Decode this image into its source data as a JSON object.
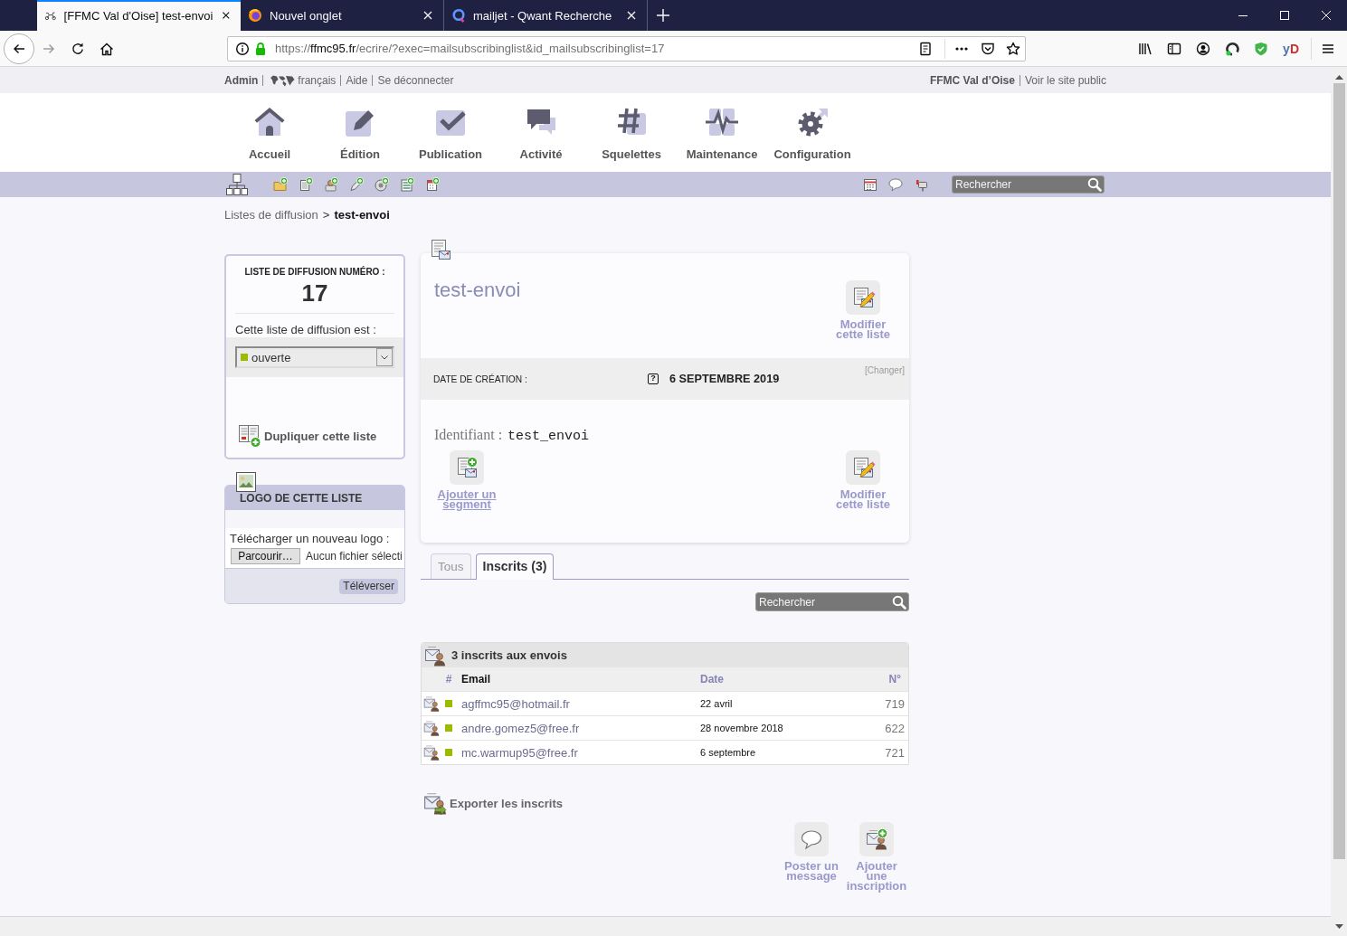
{
  "browser": {
    "tabs": [
      {
        "title": "[FFMC Val d'Oise] test-envoi",
        "kind": "site",
        "selected": true
      },
      {
        "title": "Nouvel onglet",
        "kind": "browser",
        "selected": false
      },
      {
        "title": "mailjet - Qwant Recherche",
        "kind": "search",
        "selected": false
      }
    ],
    "address": {
      "scheme": "https://",
      "host": "ffmc95.fr",
      "path": "/ecrire/?exec=mailsubscribinglist&id_mailsubscribinglist=17"
    },
    "extension_label": "yD"
  },
  "admin_bar": {
    "user": "Admin",
    "language": "français",
    "links": [
      "Aide",
      "Se déconnecter"
    ],
    "site_name": "FFMC Val d’Oise",
    "site_link": "Voir le site public"
  },
  "main_nav": [
    {
      "label": "Accueil",
      "kind": "home"
    },
    {
      "label": "Édition",
      "kind": "edit"
    },
    {
      "label": "Publication",
      "kind": "publish"
    },
    {
      "label": "Activité",
      "kind": "activity"
    },
    {
      "label": "Squelettes",
      "kind": "templates"
    },
    {
      "label": "Maintenance",
      "kind": "maintenance"
    },
    {
      "label": "Configuration",
      "kind": "config"
    }
  ],
  "toolbar": {
    "search": {
      "placeholder": "Rechercher"
    }
  },
  "breadcrumb": {
    "items": [
      {
        "label": "Listes de diffusion",
        "kind": "link"
      },
      {
        "label": "test-envoi",
        "kind": "current"
      }
    ],
    "separator": ">"
  },
  "sidebar": {
    "list_number": {
      "label": "LISTE DE DIFFUSION NUMÉRO :",
      "value": "17"
    },
    "status": {
      "label": "Cette liste de diffusion est :",
      "value": "ouverte"
    },
    "duplicate": "Dupliquer cette liste",
    "logo": {
      "title": "LOGO DE CETTE LISTE",
      "upload_label": "Télécharger un nouveau logo :",
      "browse": "Parcourir…",
      "file": "Aucun fichier sélecti",
      "submit": "Téléverser"
    }
  },
  "list_card": {
    "title": "test-envoi",
    "header_action": {
      "label": "Modifier cette liste",
      "kind": "edit"
    },
    "creation_date": {
      "label": "DATE DE CRÉATION :",
      "help": "?",
      "value": "6 SEPTEMBRE 2019",
      "change": "[Changer]"
    },
    "identifier": {
      "label": "Identifiant :",
      "value": "test_envoi"
    },
    "actions": [
      {
        "label": "Ajouter un segment",
        "kind": "segment"
      },
      {
        "label": "Modifier cette liste",
        "kind": "edit"
      }
    ]
  },
  "subscriber_tabs": [
    {
      "label": "Tous",
      "selected": false
    },
    {
      "label": "Inscrits (3)",
      "selected": true
    }
  ],
  "search": {
    "placeholder": "Rechercher"
  },
  "subscribers": {
    "title": "3 inscrits aux envois",
    "columns": [
      {
        "label": "#",
        "sorted": false
      },
      {
        "label": "Email",
        "sorted": true
      },
      {
        "label": "Date",
        "sorted": false
      },
      {
        "label": "N°",
        "sorted": false
      }
    ],
    "rows": [
      {
        "email": "agffmc95@hotmail.fr",
        "date": "22 avril",
        "number": "719",
        "color": "#99bb00"
      },
      {
        "email": "andre.gomez5@free.fr",
        "date": "28 novembre 2018",
        "number": "622",
        "color": "#99bb00"
      },
      {
        "email": "mc.warmup95@free.fr",
        "date": "6 septembre",
        "number": "721",
        "color": "#99bb00"
      }
    ]
  },
  "export": "Exporter les inscrits",
  "actions": [
    {
      "label": "Poster un message",
      "kind": "message"
    },
    {
      "label": "Ajouter une inscription",
      "kind": "subscribe"
    }
  ]
}
